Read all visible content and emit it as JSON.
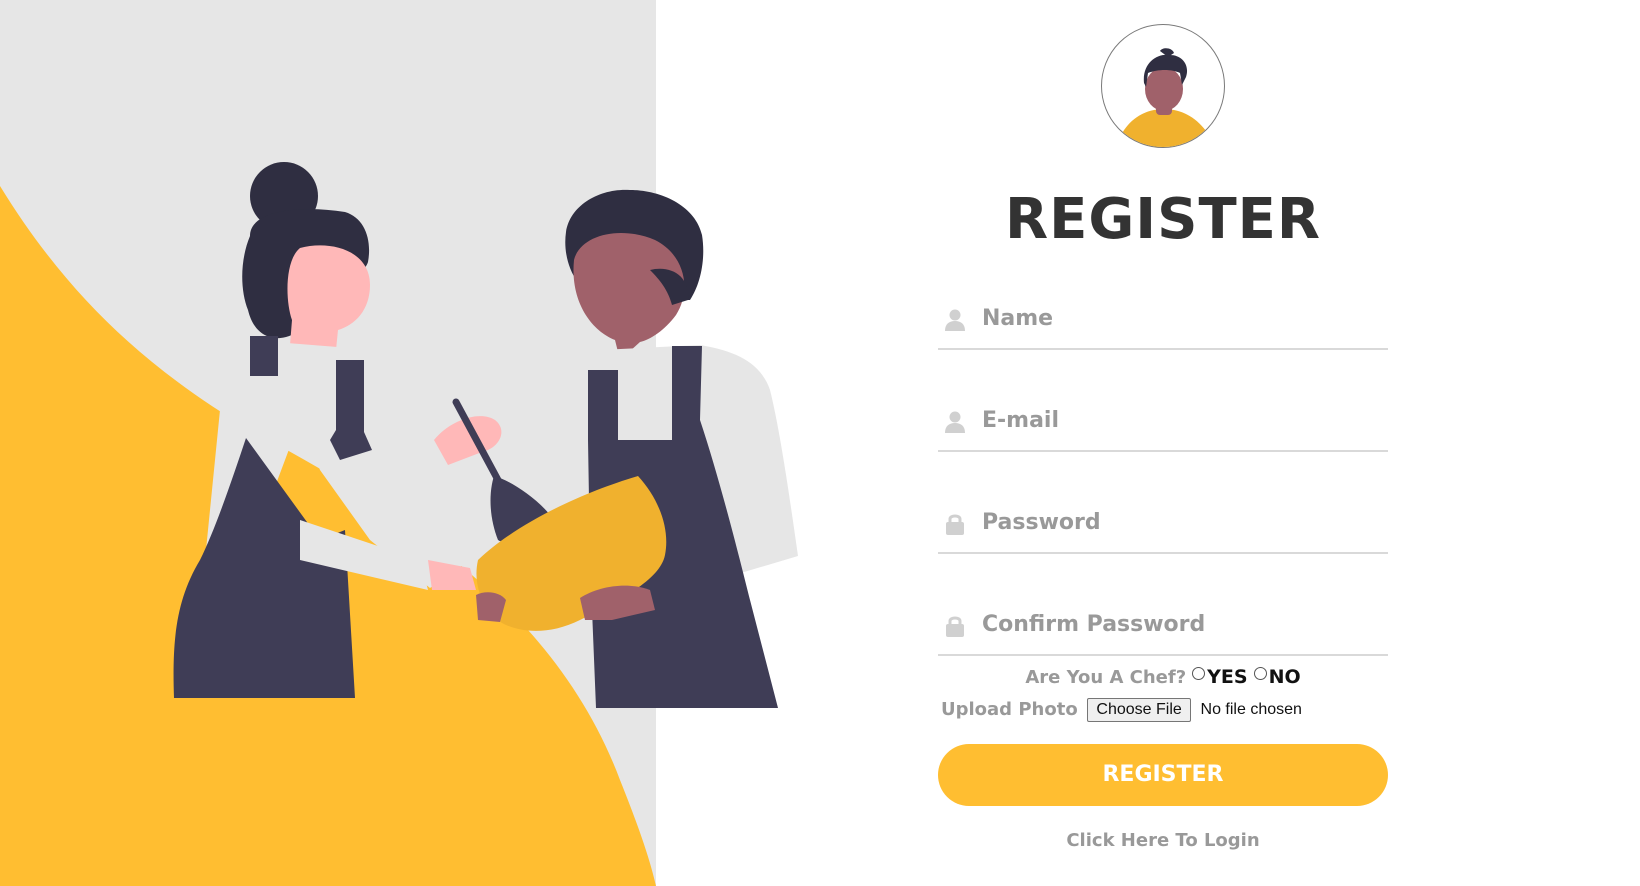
{
  "colors": {
    "accent": "#ffbe31",
    "left_background": "#e6e6e6",
    "title": "#333333",
    "placeholder": "#999999"
  },
  "form": {
    "title": "REGISTER",
    "fields": [
      {
        "placeholder": "Name",
        "icon": "user-icon"
      },
      {
        "placeholder": "E-mail",
        "icon": "user-icon"
      },
      {
        "placeholder": "Password",
        "icon": "lock-icon"
      },
      {
        "placeholder": "Confirm Password",
        "icon": "lock-icon"
      }
    ],
    "chef_question": "Are You A Chef?",
    "chef_yes": "YES",
    "chef_no": "NO",
    "upload_label": "Upload Photo",
    "choose_file": "Choose File",
    "no_file": "No file chosen",
    "submit": "REGISTER",
    "login_link": "Click Here To Login"
  }
}
